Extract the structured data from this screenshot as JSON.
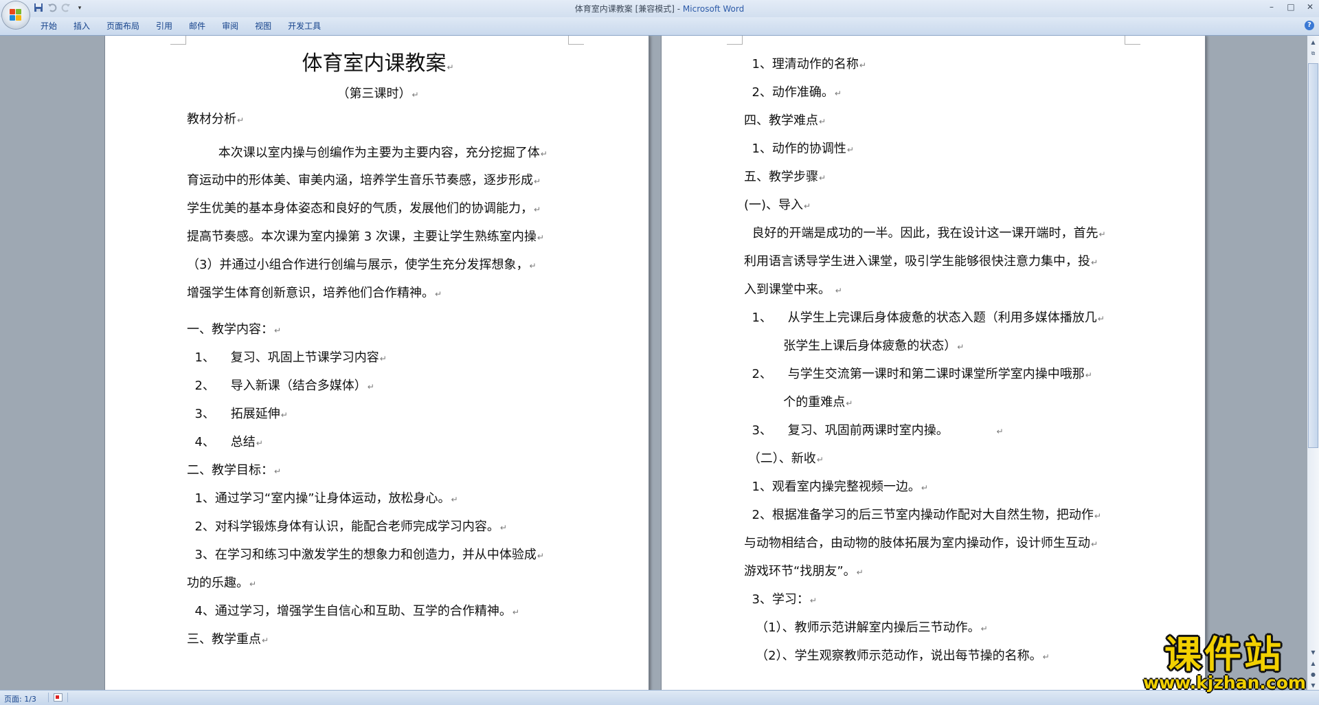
{
  "window": {
    "title": "体育室内课教案 [兼容模式] - ",
    "app_name": "Microsoft Word",
    "controls": {
      "minimize": "–",
      "maximize": "□",
      "close": "✕"
    }
  },
  "quick_access": {
    "save": "save-icon",
    "undo": "undo-icon",
    "redo": "redo-icon",
    "customize": "▾"
  },
  "ribbon": {
    "tabs": [
      {
        "label": "开始"
      },
      {
        "label": "插入"
      },
      {
        "label": "页面布局"
      },
      {
        "label": "引用"
      },
      {
        "label": "邮件"
      },
      {
        "label": "审阅"
      },
      {
        "label": "视图"
      },
      {
        "label": "开发工具"
      }
    ],
    "help": "?"
  },
  "page1": {
    "title": "体育室内课教案",
    "subtitle": "（第三课时）",
    "lines": [
      "教材分析",
      "        本次课以室内操与创编作为主要为主要内容，充分挖掘了体",
      "育运动中的形体美、审美内涵，培养学生音乐节奏感，逐步形成",
      "学生优美的基本身体姿态和良好的气质，发展他们的协调能力，",
      "提高节奏感。本次课为室内操第 3 次课，主要让学生熟练室内操",
      "（3）并通过小组合作进行创编与展示，使学生充分发挥想象，",
      "增强学生体育创新意识，培养他们合作精神。",
      "一、教学内容：",
      "  1、    复习、巩固上节课学习内容",
      "  2、    导入新课（结合多媒体）",
      "  3、    拓展延伸",
      "  4、    总结",
      "二、教学目标：",
      "  1、通过学习“室内操”让身体运动，放松身心。",
      "  2、对科学锻炼身体有认识，能配合老师完成学习内容。",
      "  3、在学习和练习中激发学生的想象力和创造力，并从中体验成",
      "功的乐趣。",
      "  4、通过学习，增强学生自信心和互助、互学的合作精神。",
      "三、教学重点"
    ]
  },
  "page2": {
    "lines": [
      "  1、理清动作的名称",
      "  2、动作准确。",
      "四、教学难点",
      "  1、动作的协调性",
      "五、教学步骤",
      "(一)、导入",
      "  良好的开端是成功的一半。因此，我在设计这一课开端时，首先",
      "利用语言诱导学生进入课堂，吸引学生能够很快注意力集中，投",
      "入到课堂中来。 ",
      "  1、    从学生上完课后身体疲惫的状态入题（利用多媒体播放几",
      "          张学生上课后身体疲惫的状态）",
      "  2、    与学生交流第一课时和第二课时课堂所学室内操中哦那",
      "          个的重难点",
      "  3、    复习、巩固前两课时室内操。            ",
      " （二）、新收",
      "  1、观看室内操完整视频一边。",
      "  2、根据准备学习的后三节室内操动作配对大自然生物，把动作",
      "与动物相结合，由动物的肢体拓展为室内操动作，设计师生互动",
      "游戏环节“找朋友”。",
      "  3、学习：",
      "   （1）、教师示范讲解室内操后三节动作。",
      "   （2）、学生观察教师示范动作，说出每节操的名称。"
    ]
  },
  "status": {
    "page": "页面: 1/3"
  },
  "watermark": {
    "main": "课件站",
    "url": "www.kjzhan.com"
  }
}
